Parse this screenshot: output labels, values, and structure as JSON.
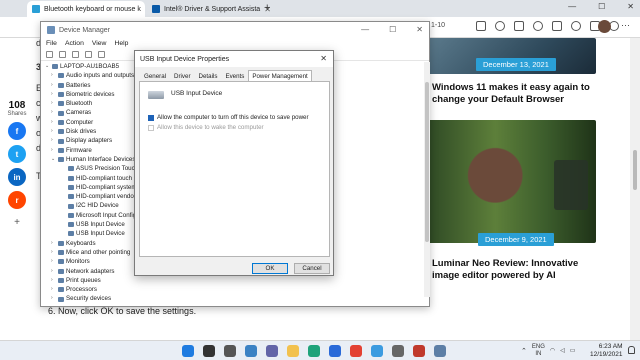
{
  "browser": {
    "tabs": [
      {
        "label": "Bluetooth keyboard or mouse k",
        "favicon_color": "#2a9fd6",
        "active": true
      },
      {
        "label": "Intel® Driver & Support Assista",
        "favicon_color": "#0a5aa8",
        "active": false
      }
    ],
    "new_tab": "+",
    "url_fragment": "1-10",
    "window_controls": [
      "—",
      "☐",
      "✕"
    ],
    "more_menu": "···"
  },
  "share": {
    "count": "108",
    "label": "Shares",
    "buttons": [
      {
        "name": "facebook",
        "glyph": "f",
        "color": "#1877f2"
      },
      {
        "name": "twitter",
        "glyph": "t",
        "color": "#1da1f2"
      },
      {
        "name": "linkedin",
        "glyph": "in",
        "color": "#0a66c2"
      },
      {
        "name": "reddit",
        "glyph": "r",
        "color": "#ff4500"
      }
    ],
    "more": "+"
  },
  "article": {
    "fragments": [
      "d",
      "3",
      "E",
      "c",
      "w",
      "o",
      "d",
      "T"
    ],
    "step_text": "6. Now, click OK to save the settings."
  },
  "cards": [
    {
      "date": "December 13, 2021",
      "title": "Windows 11 makes it easy again to change your Default Browser"
    },
    {
      "date": "December 9, 2021",
      "title": "Luminar Neo Review: Innovative image editor powered by AI"
    }
  ],
  "device_manager": {
    "title": "Device Manager",
    "window_controls": [
      "—",
      "☐",
      "✕"
    ],
    "menu": [
      "File",
      "Action",
      "View",
      "Help"
    ],
    "tree": [
      {
        "label": "LAPTOP-AU1BOAB5",
        "level": 0,
        "twisty": "⌄"
      },
      {
        "label": "Audio inputs and outputs",
        "level": 1,
        "twisty": "›"
      },
      {
        "label": "Batteries",
        "level": 1,
        "twisty": "›"
      },
      {
        "label": "Biometric devices",
        "level": 1,
        "twisty": "›"
      },
      {
        "label": "Bluetooth",
        "level": 1,
        "twisty": "›"
      },
      {
        "label": "Cameras",
        "level": 1,
        "twisty": "›"
      },
      {
        "label": "Computer",
        "level": 1,
        "twisty": "›"
      },
      {
        "label": "Disk drives",
        "level": 1,
        "twisty": "›"
      },
      {
        "label": "Display adapters",
        "level": 1,
        "twisty": "›"
      },
      {
        "label": "Firmware",
        "level": 1,
        "twisty": "›"
      },
      {
        "label": "Human Interface Devices",
        "level": 1,
        "twisty": "⌄"
      },
      {
        "label": "ASUS Precision Touch",
        "level": 2,
        "twisty": ""
      },
      {
        "label": "HID-compliant touch",
        "level": 2,
        "twisty": ""
      },
      {
        "label": "HID-compliant system",
        "level": 2,
        "twisty": ""
      },
      {
        "label": "HID-compliant vendor",
        "level": 2,
        "twisty": ""
      },
      {
        "label": "I2C HID Device",
        "level": 2,
        "twisty": ""
      },
      {
        "label": "Microsoft Input Configuration",
        "level": 2,
        "twisty": ""
      },
      {
        "label": "USB Input Device",
        "level": 2,
        "twisty": ""
      },
      {
        "label": "USB Input Device",
        "level": 2,
        "twisty": ""
      },
      {
        "label": "Keyboards",
        "level": 1,
        "twisty": "›"
      },
      {
        "label": "Mice and other pointing",
        "level": 1,
        "twisty": "›"
      },
      {
        "label": "Monitors",
        "level": 1,
        "twisty": "›"
      },
      {
        "label": "Network adapters",
        "level": 1,
        "twisty": "›"
      },
      {
        "label": "Print queues",
        "level": 1,
        "twisty": "›"
      },
      {
        "label": "Processors",
        "level": 1,
        "twisty": "›"
      },
      {
        "label": "Security devices",
        "level": 1,
        "twisty": "›"
      }
    ]
  },
  "dialog": {
    "title": "USB Input Device Properties",
    "close": "✕",
    "tabs": [
      "General",
      "Driver",
      "Details",
      "Events",
      "Power Management"
    ],
    "device_name": "USB Input Device",
    "options": [
      {
        "label": "Allow the computer to turn off this device to save power",
        "checked": true,
        "enabled": true
      },
      {
        "label": "Allow this device to wake the computer",
        "checked": false,
        "enabled": false
      }
    ],
    "ok_label": "OK",
    "cancel_label": "Cancel"
  },
  "taskbar": {
    "apps": [
      {
        "name": "windows-start-icon",
        "color": "#1e7be0"
      },
      {
        "name": "search-icon",
        "color": "#333333"
      },
      {
        "name": "task-view-icon",
        "color": "#555555"
      },
      {
        "name": "widgets-icon",
        "color": "#3b82c4"
      },
      {
        "name": "chat-icon",
        "color": "#6264a7"
      },
      {
        "name": "file-explorer-icon",
        "color": "#f2c14e"
      },
      {
        "name": "edge-icon",
        "color": "#1fa37a"
      },
      {
        "name": "store-icon",
        "color": "#2a6ad8"
      },
      {
        "name": "chrome-icon",
        "color": "#e34133"
      },
      {
        "name": "photos-icon",
        "color": "#3b9be0"
      },
      {
        "name": "settings-icon",
        "color": "#666666"
      },
      {
        "name": "app-icon",
        "color": "#c0392b"
      },
      {
        "name": "device-manager-icon",
        "color": "#5d7fa6"
      }
    ],
    "lang_top": "ENG",
    "lang_bottom": "IN",
    "time": "6:23 AM",
    "date": "12/19/2021"
  }
}
